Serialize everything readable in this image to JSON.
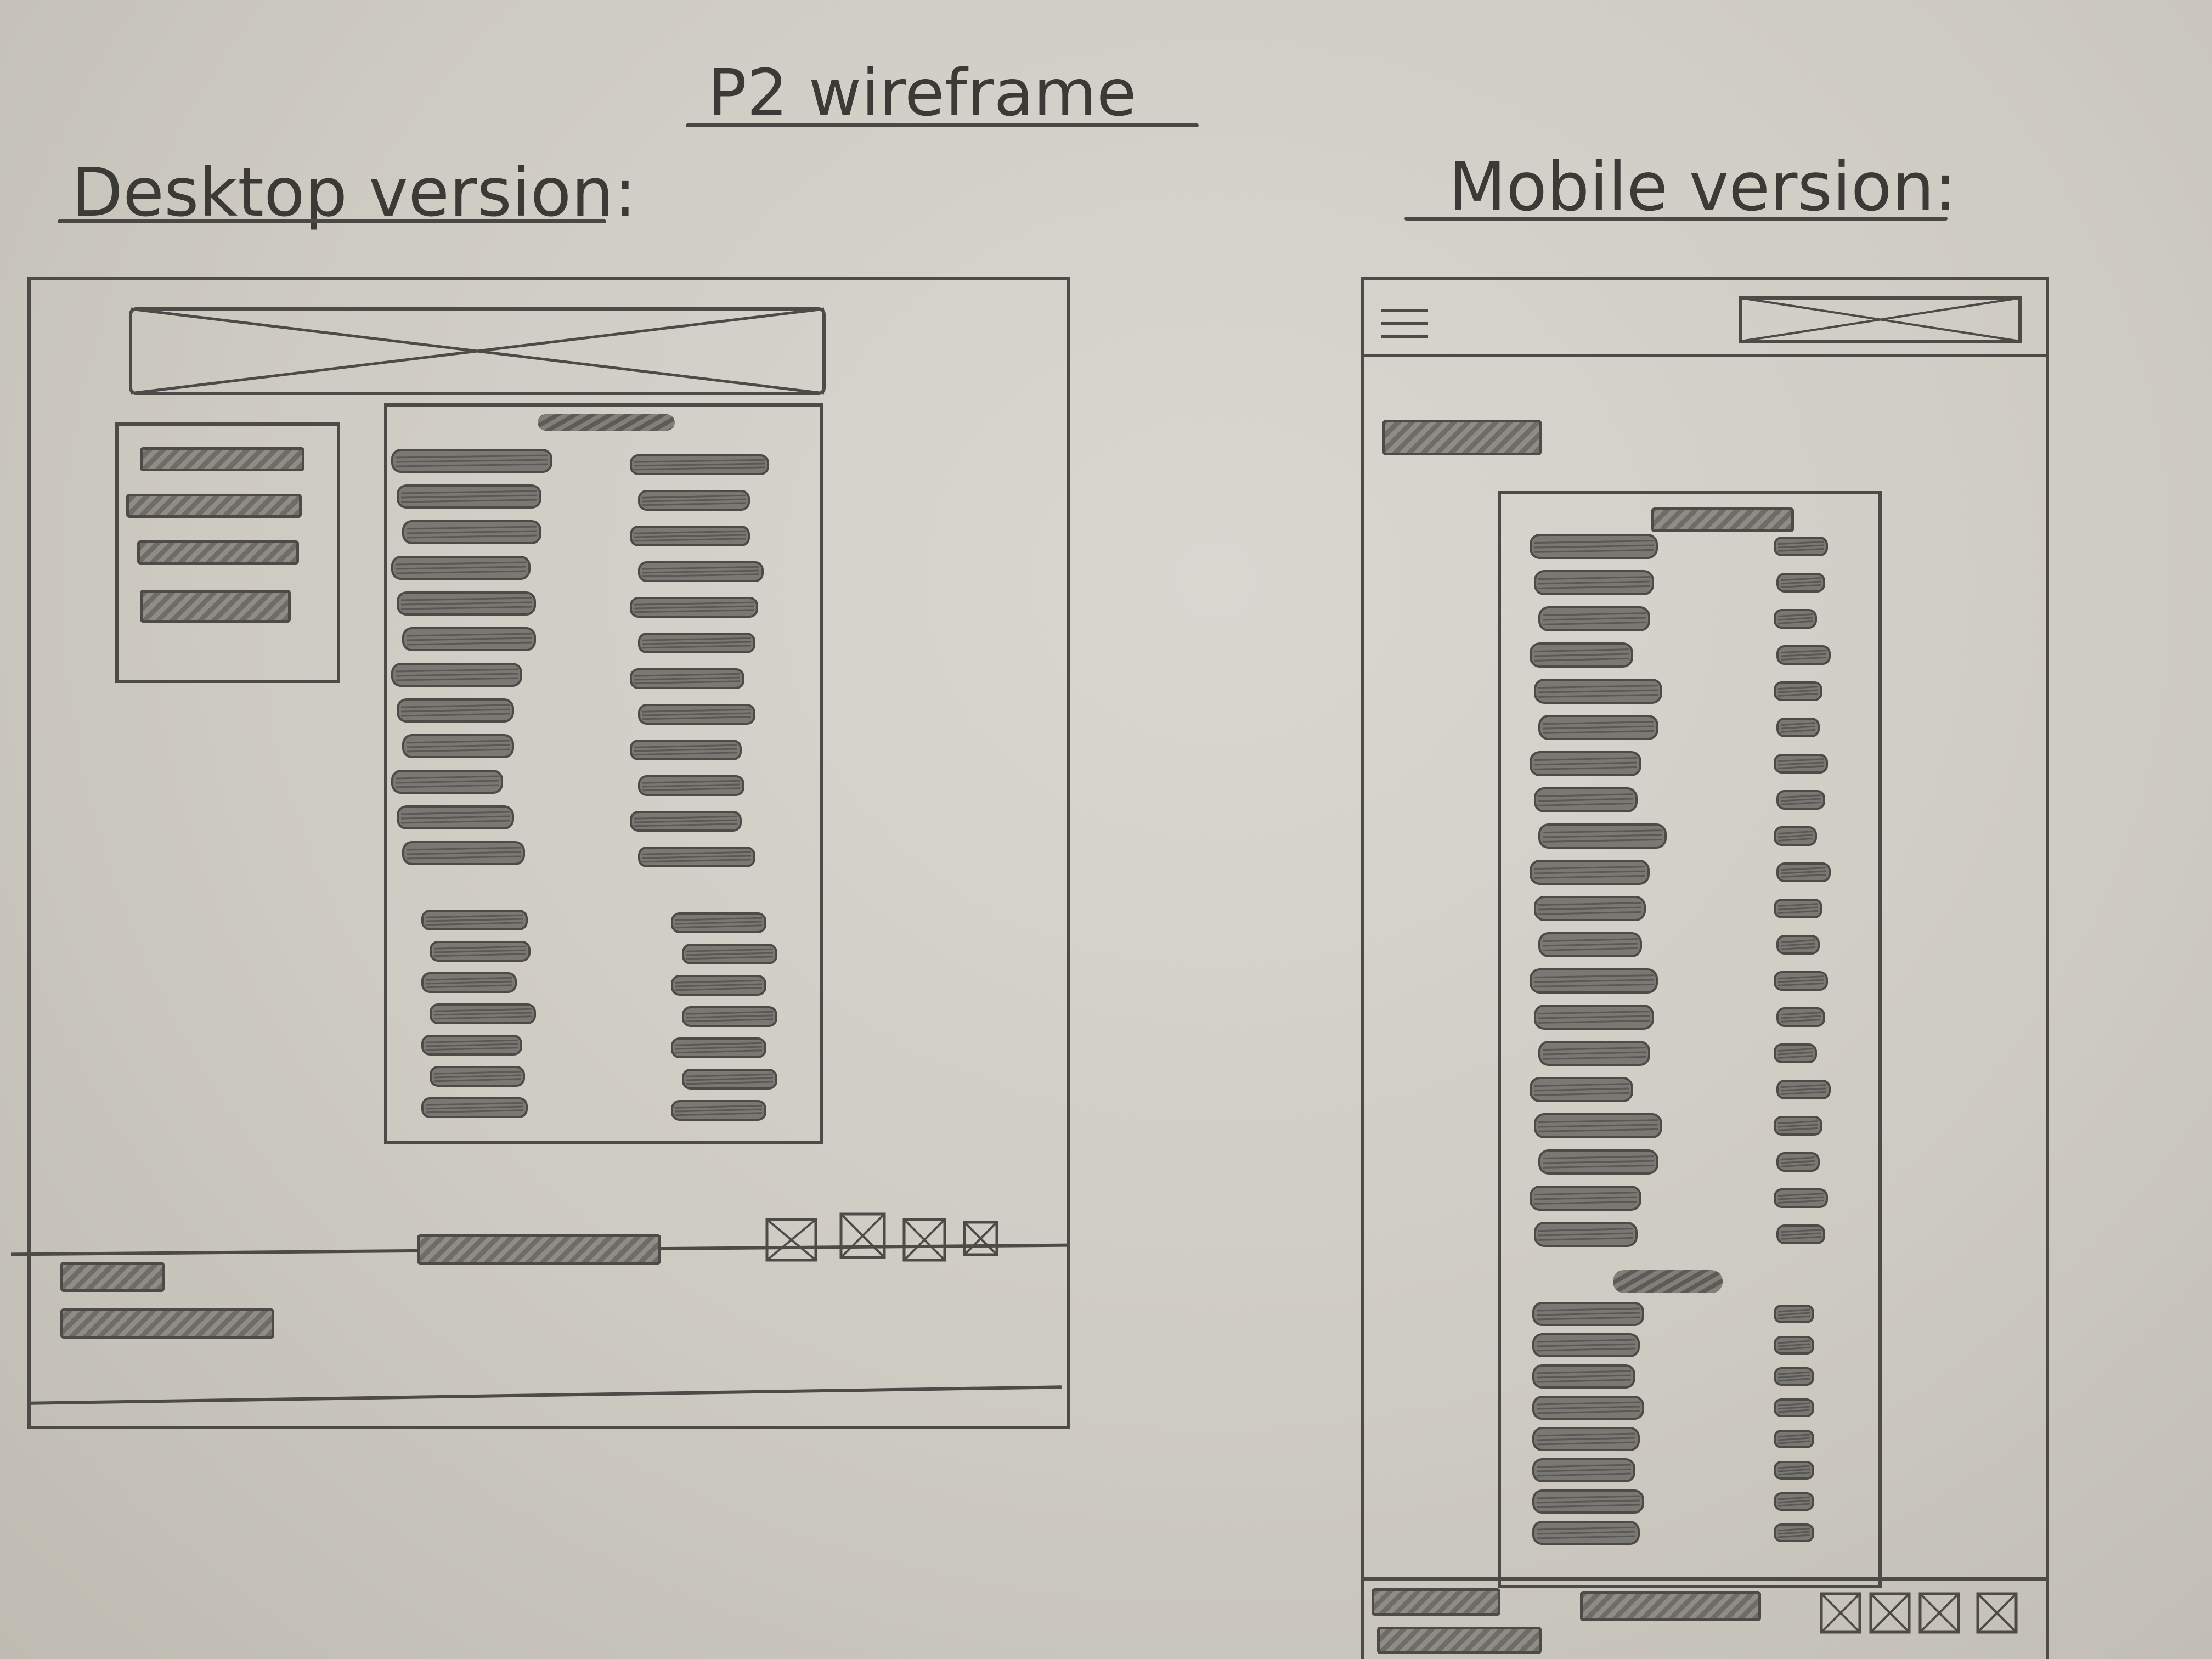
{
  "title": "P2 wireframe",
  "desktop": {
    "label": "Desktop version:"
  },
  "mobile": {
    "label": "Mobile version:"
  },
  "colors": {
    "pencil": "#4d4b47",
    "paper": "#d4d2cb"
  },
  "icons": [
    "menu-icon",
    "image-placeholder-icon",
    "social-icon"
  ]
}
